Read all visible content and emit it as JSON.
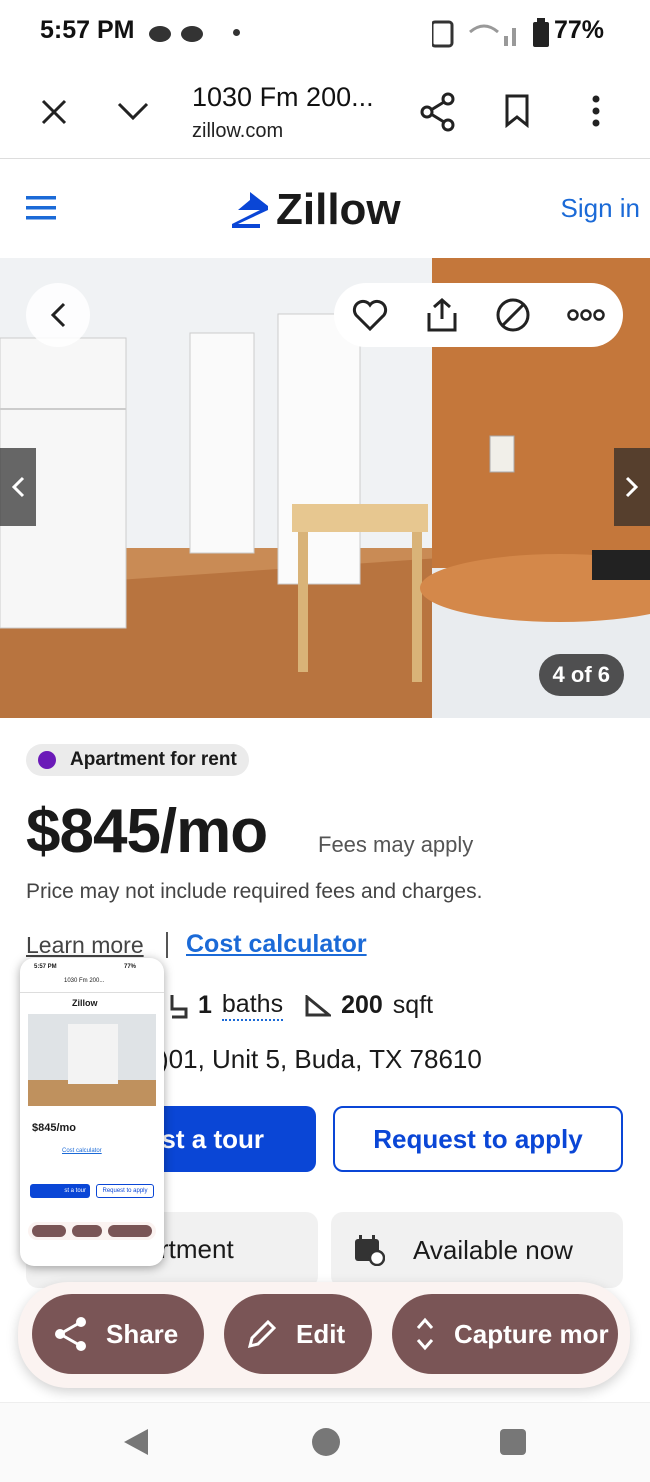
{
  "status": {
    "time": "5:57 PM",
    "battery": "77%"
  },
  "browser": {
    "title": "1030 Fm 200...",
    "url": "zillow.com"
  },
  "header": {
    "brand": "Zillow",
    "signin": "Sign in"
  },
  "photo": {
    "counter": "4 of 6"
  },
  "listing": {
    "type": "Apartment for rent",
    "price": "$845/mo",
    "fees": "Fees may apply",
    "note": "Price may not include required fees and charges.",
    "learn_more": "Learn more",
    "cost_calc": "Cost calculator",
    "baths_num": "1",
    "baths_label": "baths",
    "sqft_num": "200",
    "sqft_label": "sqft",
    "address": ")01, Unit 5, Buda, TX 78610",
    "tour_btn": "st a tour",
    "apply_btn": "Request to apply",
    "chip_type": "rtment",
    "chip_available": "Available now"
  },
  "share_sheet": {
    "share": "Share",
    "edit": "Edit",
    "capture": "Capture mor"
  },
  "thumbnail": {
    "time": "5:57 PM",
    "batt": "77%",
    "title": "1030 Fm 200...",
    "brand": "Zillow",
    "price": "$845/mo",
    "calc": "Cost calculator",
    "tour": "st a tour",
    "apply": "Request to apply"
  },
  "colors": {
    "zillow_blue": "#0a46d6",
    "link_blue": "#1b6ad7",
    "sheet_btn": "#7a5556"
  }
}
